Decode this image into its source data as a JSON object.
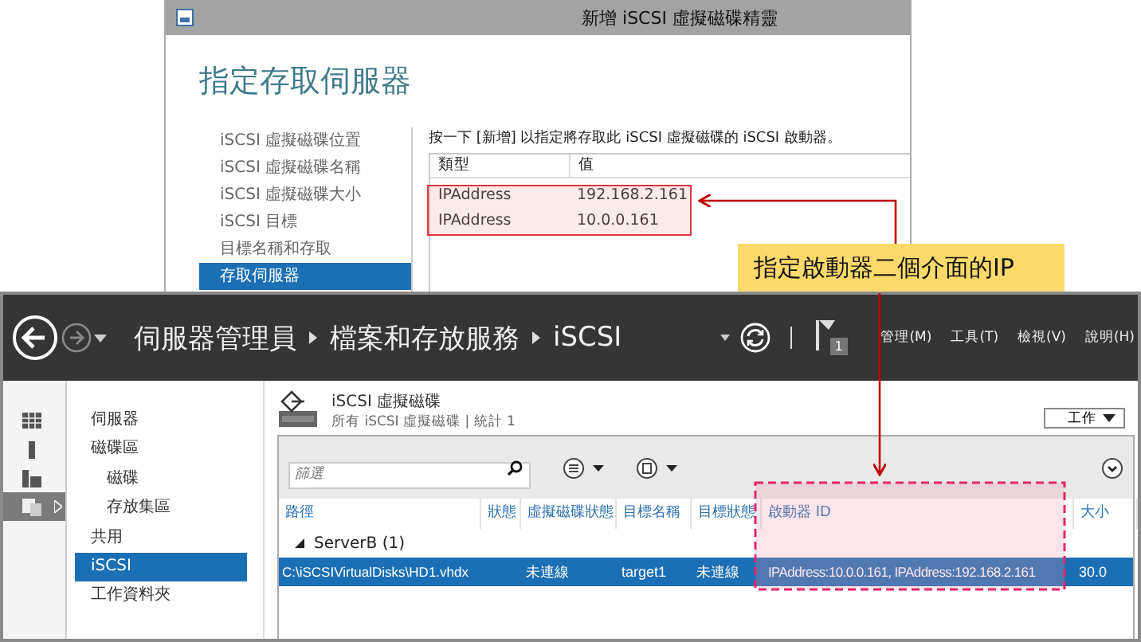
{
  "wizard": {
    "title": "新增 iSCSI 虛擬磁碟精靈",
    "heading": "指定存取伺服器",
    "steps": [
      {
        "label": "iSCSI 虛擬磁碟位置",
        "selected": false
      },
      {
        "label": "iSCSI 虛擬磁碟名稱",
        "selected": false
      },
      {
        "label": "iSCSI 虛擬磁碟大小",
        "selected": false
      },
      {
        "label": "iSCSI 目標",
        "selected": false
      },
      {
        "label": "目標名稱和存取",
        "selected": false
      },
      {
        "label": "存取伺服器",
        "selected": true
      }
    ],
    "instruction": "按一下 [新增] 以指定將存取此 iSCSI 虛擬磁碟的 iSCSI 啟動器。",
    "table": {
      "columns": [
        "類型",
        "值"
      ],
      "rows": [
        [
          "IPAddress",
          "192.168.2.161"
        ],
        [
          "IPAddress",
          "10.0.0.161"
        ]
      ]
    }
  },
  "callout": {
    "text": "指定啟動器二個介面的IP"
  },
  "server_manager": {
    "breadcrumb": [
      "伺服器管理員",
      "檔案和存放服務",
      "iSCSI"
    ],
    "notification_count": "1",
    "menus": [
      "管理(M)",
      "工具(T)",
      "檢視(V)",
      "說明(H)"
    ],
    "rail": [
      {
        "kind": "dashboard",
        "selected": false
      },
      {
        "kind": "server",
        "selected": false
      },
      {
        "kind": "servers",
        "selected": false
      },
      {
        "kind": "storage",
        "selected": true
      }
    ],
    "nav": [
      {
        "label": "伺服器",
        "selected": false
      },
      {
        "label": "磁碟區",
        "selected": false,
        "children": [
          {
            "label": "磁碟",
            "selected": false
          },
          {
            "label": "存放集區",
            "selected": false
          }
        ]
      },
      {
        "label": "共用",
        "selected": false
      },
      {
        "label": "iSCSI",
        "selected": true
      },
      {
        "label": "工作資料夾",
        "selected": false
      }
    ],
    "section_title": "iSCSI 虛擬磁碟",
    "section_subtitle": "所有 iSCSI 虛擬磁碟 | 統計 1",
    "tasks_button": "工作",
    "filter": {
      "placeholder": "篩選"
    },
    "table": {
      "columns": [
        "路徑",
        "狀態",
        "虛擬磁碟狀態",
        "目標名稱",
        "目標狀態",
        "啟動器 ID",
        "大小"
      ],
      "groups": [
        {
          "label": "ServerB (1)",
          "expanded": true,
          "rows": [
            {
              "cells": [
                "C:\\iSCSIVirtualDisks\\HD1.vhdx",
                "",
                "未連線",
                "target1",
                "未連線",
                "IPAddress:10.0.0.161, IPAddress:192.168.2.161",
                "30.0"
              ],
              "selected": true
            }
          ]
        }
      ]
    }
  }
}
